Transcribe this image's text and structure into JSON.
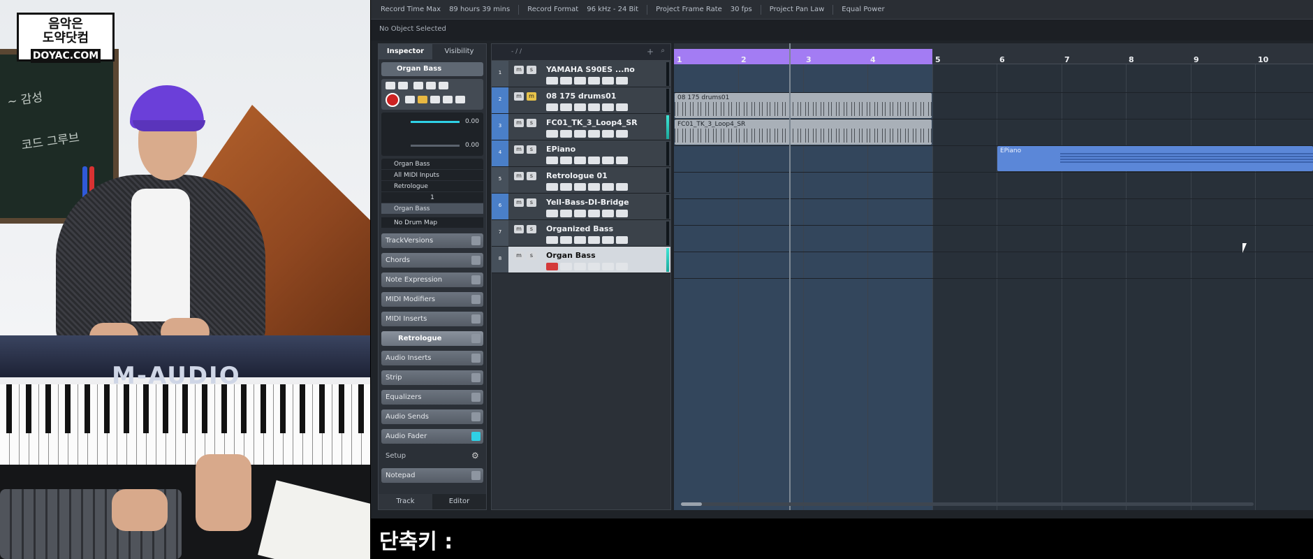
{
  "camera": {
    "logo_line1": "음악은",
    "logo_line2": "도약닷컴",
    "logo_url": "DOYAC.COM",
    "keyboard_brand": "M-AUDIO"
  },
  "status": {
    "record_time_label": "Record Time Max",
    "record_time_value": "89 hours 39 mins",
    "record_format_label": "Record Format",
    "record_format_value": "96 kHz - 24 Bit",
    "frame_rate_label": "Project Frame Rate",
    "frame_rate_value": "30 fps",
    "pan_law_label": "Project Pan Law",
    "pan_law_value": "Equal Power"
  },
  "info_line": "No Object Selected",
  "inspector": {
    "tab_inspector": "Inspector",
    "tab_visibility": "Visibility",
    "track_name": "Organ Bass",
    "volume_value": "0.00",
    "pan_value": "0.00",
    "routing": [
      "Organ Bass",
      "All MIDI Inputs",
      "Retrologue",
      "1"
    ],
    "instrument": "Organ Bass",
    "drum_map": "No Drum Map",
    "sections": [
      "TrackVersions",
      "Chords",
      "Note Expression",
      "MIDI Modifiers",
      "MIDI Inserts"
    ],
    "instrument_slot": "Retrologue",
    "sections2": [
      "Audio Inserts",
      "Strip",
      "Equalizers",
      "Audio Sends",
      "Audio Fader"
    ],
    "setup": "Setup",
    "notepad": "Notepad",
    "bottom_track": "Track",
    "bottom_editor": "Editor"
  },
  "tracklist": {
    "header": "- / /",
    "tracks": [
      {
        "num": "1",
        "name": "YAMAHA S90ES ...no"
      },
      {
        "num": "2",
        "name": "08 175 drums01"
      },
      {
        "num": "3",
        "name": "FC01_TK_3_Loop4_SR"
      },
      {
        "num": "4",
        "name": "EPiano"
      },
      {
        "num": "5",
        "name": "Retrologue 01"
      },
      {
        "num": "6",
        "name": "Yell-Bass-DI-Bridge"
      },
      {
        "num": "7",
        "name": "Organized Bass"
      },
      {
        "num": "8",
        "name": "Organ Bass"
      }
    ]
  },
  "arrange": {
    "bars": [
      "1",
      "2",
      "3",
      "4",
      "5",
      "6",
      "7",
      "8",
      "9",
      "10"
    ],
    "events": [
      {
        "name": "08 175 drums01"
      },
      {
        "name": "FC01_TK_3_Loop4_SR"
      },
      {
        "name": "EPiano"
      }
    ]
  },
  "caption": "단축키 :"
}
